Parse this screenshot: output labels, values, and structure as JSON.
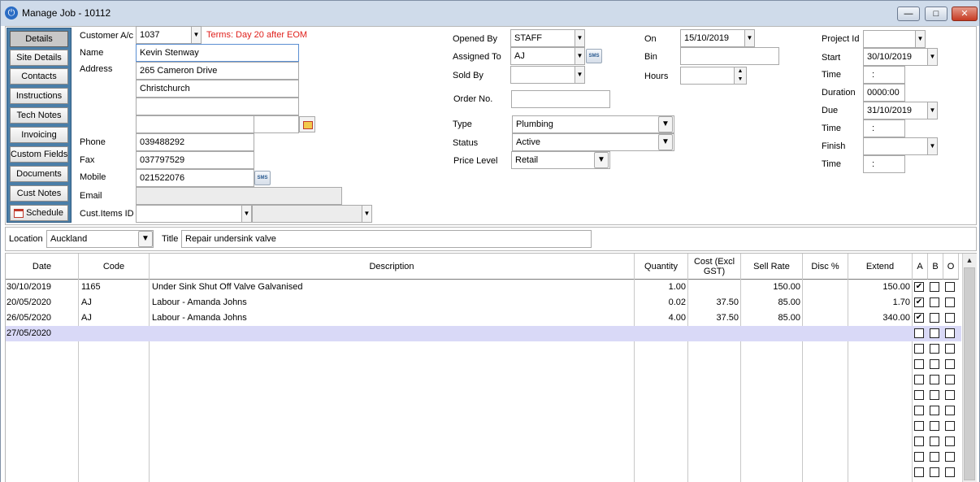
{
  "window": {
    "title": "Manage Job - 10112",
    "minimize": "—",
    "maximize": "□",
    "close": "✕"
  },
  "nav": [
    "Details",
    "Site Details",
    "Contacts",
    "Instructions",
    "Tech Notes",
    "Invoicing",
    "Custom Fields",
    "Documents",
    "Cust Notes",
    "Schedule"
  ],
  "customer": {
    "account_label": "Customer A/c",
    "account": "1037",
    "terms": "Terms: Day 20 after EOM",
    "name_label": "Name",
    "name": "Kevin Stenway",
    "address_label": "Address",
    "address1": "265 Cameron Drive",
    "address2": "Christchurch",
    "phone_label": "Phone",
    "phone": "039488292",
    "fax_label": "Fax",
    "fax": "037797529",
    "mobile_label": "Mobile",
    "mobile": "021522076",
    "email_label": "Email",
    "email": "",
    "items_label": "Cust.Items ID"
  },
  "job": {
    "opened_by_label": "Opened By",
    "opened_by": "STAFF",
    "assigned_to_label": "Assigned To",
    "assigned_to": "AJ",
    "sold_by_label": "Sold By",
    "sold_by": "",
    "order_no_label": "Order No.",
    "order_no": "",
    "type_label": "Type",
    "type": "Plumbing",
    "status_label": "Status",
    "status": "Active",
    "price_level_label": "Price Level",
    "price_level": "Retail",
    "on_label": "On",
    "on": "15/10/2019",
    "bin_label": "Bin",
    "bin": "",
    "hours_label": "Hours",
    "hours": ""
  },
  "schedule": {
    "project_label": "Project Id",
    "project": "",
    "start_label": "Start",
    "start": "30/10/2019",
    "time_label": "Time",
    "start_time": ":",
    "duration_label": "Duration",
    "duration": "0000:00",
    "due_label": "Due",
    "due": "31/10/2019",
    "due_time": ":",
    "finish_label": "Finish",
    "finish": "",
    "finish_time": ":"
  },
  "location": {
    "label": "Location",
    "value": "Auckland",
    "title_label": "Title",
    "title": "Repair undersink valve"
  },
  "grid": {
    "columns": [
      "Date",
      "Code",
      "Description",
      "Quantity",
      "Cost (Excl GST)",
      "Sell Rate",
      "Disc %",
      "Extend",
      "A",
      "B",
      "O"
    ],
    "rows": [
      {
        "date": "30/10/2019",
        "code": "1165",
        "desc": "Under Sink Shut Off Valve Galvanised",
        "qty": "1.00",
        "cost": "",
        "sell": "150.00",
        "disc": "",
        "extend": "150.00",
        "a": true,
        "b": false,
        "o": false
      },
      {
        "date": "20/05/2020",
        "code": "AJ",
        "desc": "Labour - Amanda Johns",
        "qty": "0.02",
        "cost": "37.50",
        "sell": "85.00",
        "disc": "",
        "extend": "1.70",
        "a": true,
        "b": false,
        "o": false
      },
      {
        "date": "26/05/2020",
        "code": "AJ",
        "desc": "Labour - Amanda Johns",
        "qty": "4.00",
        "cost": "37.50",
        "sell": "85.00",
        "disc": "",
        "extend": "340.00",
        "a": true,
        "b": false,
        "o": false
      },
      {
        "date": "27/05/2020",
        "code": "",
        "desc": "",
        "qty": "",
        "cost": "",
        "sell": "",
        "disc": "",
        "extend": "",
        "a": false,
        "b": false,
        "o": false
      }
    ],
    "empty_checkbox_rows": 9
  },
  "icons": {
    "sms": "SMS",
    "check": "✔",
    "dropdown": "▼",
    "scroll_up": "▲"
  }
}
